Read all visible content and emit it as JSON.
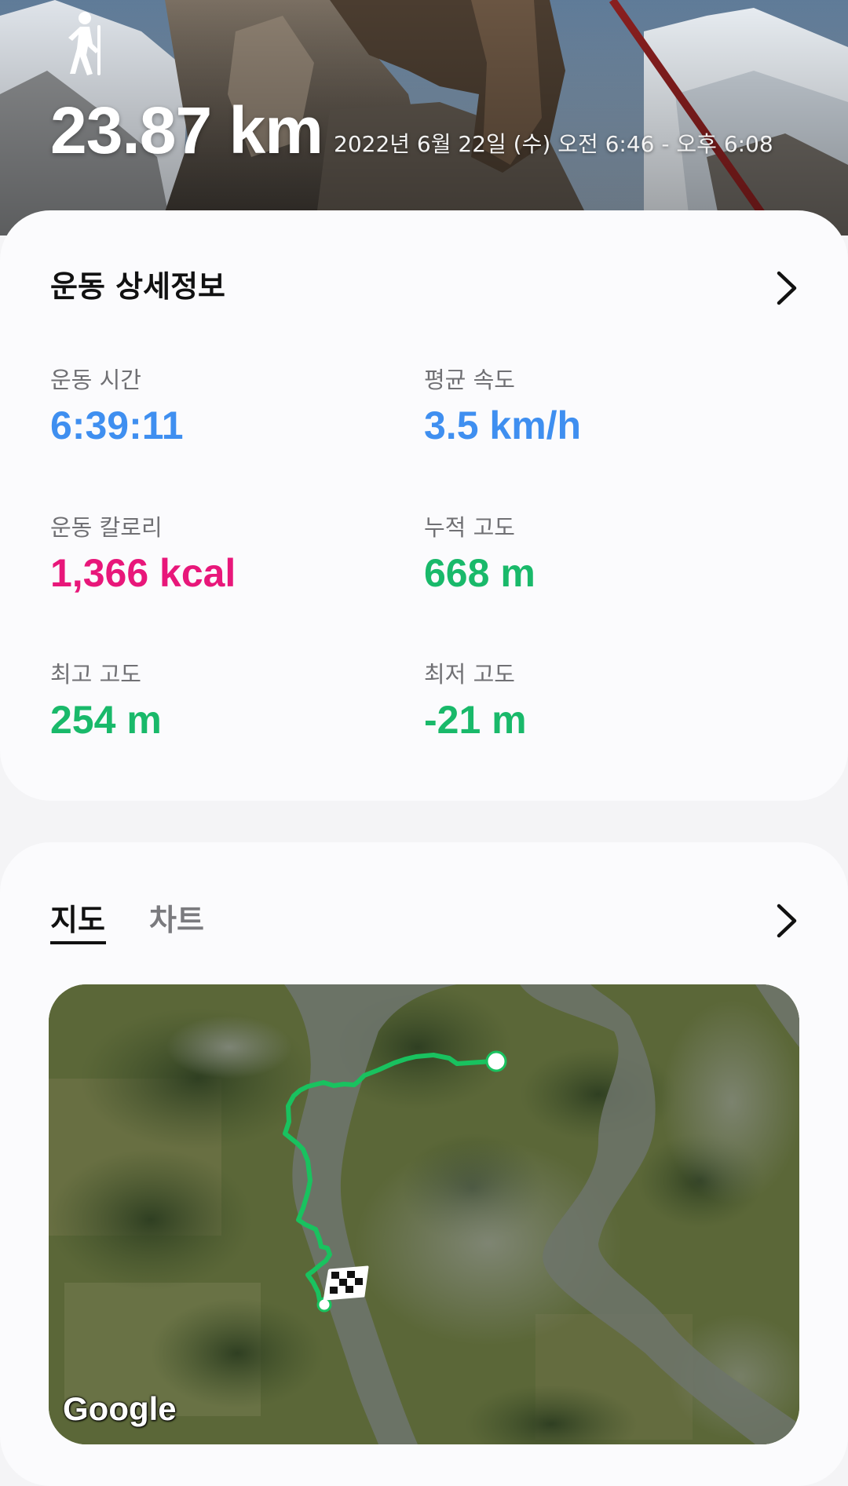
{
  "header": {
    "activity_icon": "hiking-icon",
    "distance": "23.87 km",
    "date_range": "2022년 6월 22일 (수) 오전 6:46 - 오후 6:08"
  },
  "details": {
    "title": "운동 상세정보",
    "chevron_icon": "chevron-right-icon",
    "stats": {
      "duration": {
        "label": "운동 시간",
        "value": "6:39:11",
        "color": "#3f8ff0"
      },
      "avg_speed": {
        "label": "평균 속도",
        "value": "3.5 km/h",
        "color": "#3f8ff0"
      },
      "calories": {
        "label": "운동 칼로리",
        "value": "1,366 kcal",
        "color": "#e8177a"
      },
      "elevation_gain": {
        "label": "누적 고도",
        "value": "668 m",
        "color": "#19b96a"
      },
      "max_altitude": {
        "label": "최고 고도",
        "value": "254 m",
        "color": "#19b96a"
      },
      "min_altitude": {
        "label": "최저 고도",
        "value": "-21 m",
        "color": "#19b96a"
      }
    }
  },
  "map_section": {
    "tabs": [
      {
        "label": "지도",
        "active": true
      },
      {
        "label": "차트",
        "active": false
      }
    ],
    "chevron_icon": "chevron-right-icon",
    "map": {
      "route_color": "#19c25f",
      "start_marker_icon": "start-point-icon",
      "finish_marker_icon": "checkered-flag-icon",
      "attribution": "Google"
    }
  }
}
